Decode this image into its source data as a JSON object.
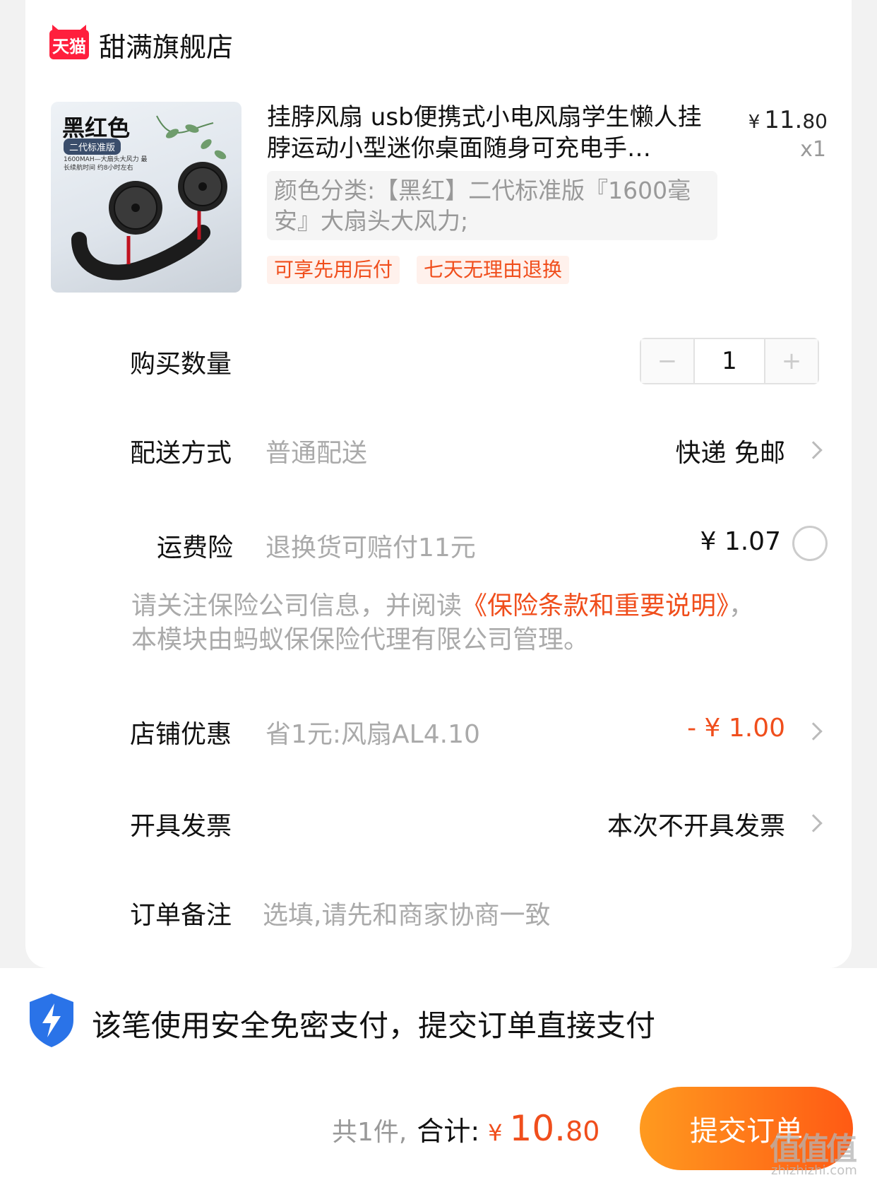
{
  "store": {
    "logo_text": "天猫",
    "name": "甜满旗舰店"
  },
  "product": {
    "image_title": "黑红色",
    "image_badge": "二代标准版",
    "image_spec": "1600MAH—大扇头大风力 最长续航时间 约8小时左右",
    "title": "挂脖风扇 usb便携式小电风扇学生懒人挂脖运动小型迷你桌面随身可充电手…",
    "price_symbol": "¥",
    "price_int": "11.",
    "price_dec": "80",
    "quantity": "x1",
    "sku": "颜色分类:【黑红】二代标准版『1600毫安』大扇头大风力;",
    "tags": [
      "可享先用后付",
      "七天无理由退换"
    ]
  },
  "quantity_row": {
    "label": "购买数量",
    "value": "1",
    "minus": "−",
    "plus": "+"
  },
  "delivery": {
    "label": "配送方式",
    "sub": "普通配送",
    "value": "快递 免邮"
  },
  "insurance": {
    "label": "运费险",
    "sub": "退换货可赔付11元",
    "price": "¥ 1.07",
    "notice_prefix": "请关注保险公司信息，并阅读",
    "notice_link": "《保险条款和重要说明》",
    "notice_suffix": "，本模块由蚂蚁保保险代理有限公司管理。"
  },
  "discount": {
    "label": "店铺优惠",
    "sub": "省1元:风扇AL4.10",
    "value": "- ¥ 1.00"
  },
  "invoice": {
    "label": "开具发票",
    "value": "本次不开具发票"
  },
  "remark": {
    "label": "订单备注",
    "placeholder": "选填,请先和商家协商一致"
  },
  "footer": {
    "secure_text": "该笔使用安全免密支付，提交订单直接支付",
    "count_text": "共1件,",
    "sum_label": "合计:",
    "total_symbol": "¥",
    "total_int": "10.",
    "total_dec": "80",
    "submit_label": "提交订单"
  },
  "watermark": {
    "text": "值值值",
    "sub": "zhizhizhi.com"
  },
  "colors": {
    "accent": "#f04e1c",
    "tmall_red": "#ff1f3d",
    "button_from": "#ff9a1f",
    "button_to": "#ff5a14"
  }
}
